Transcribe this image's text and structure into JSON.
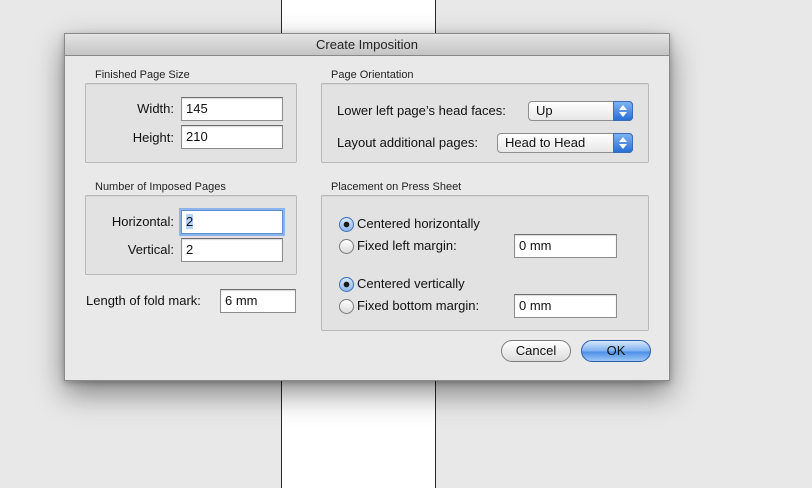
{
  "dialog": {
    "title": "Create Imposition",
    "finished_page_size": {
      "group_label": "Finished Page Size",
      "width_label": "Width:",
      "width_value": "145",
      "height_label": "Height:",
      "height_value": "210"
    },
    "page_orientation": {
      "group_label": "Page Orientation",
      "head_faces_label": "Lower left page’s head faces:",
      "head_faces_value": "Up",
      "layout_label": "Layout additional pages:",
      "layout_value": "Head to Head"
    },
    "imposed_pages": {
      "group_label": "Number of Imposed Pages",
      "horizontal_label": "Horizontal:",
      "horizontal_value": "2",
      "vertical_label": "Vertical:",
      "vertical_value": "2"
    },
    "fold_mark": {
      "label": "Length of fold mark:",
      "value": "6 mm"
    },
    "placement": {
      "group_label": "Placement on Press Sheet",
      "centered_h_label": "Centered horizontally",
      "fixed_left_label": "Fixed left margin:",
      "fixed_left_value": "0 mm",
      "centered_v_label": "Centered vertically",
      "fixed_bottom_label": "Fixed bottom margin:",
      "fixed_bottom_value": "0 mm",
      "horizontal_selected": "Centered horizontally",
      "vertical_selected": "Centered vertically"
    },
    "buttons": {
      "cancel": "Cancel",
      "ok": "OK"
    }
  },
  "colors": {
    "accent": "#4d90e6",
    "selection": "#b5d3ff"
  }
}
